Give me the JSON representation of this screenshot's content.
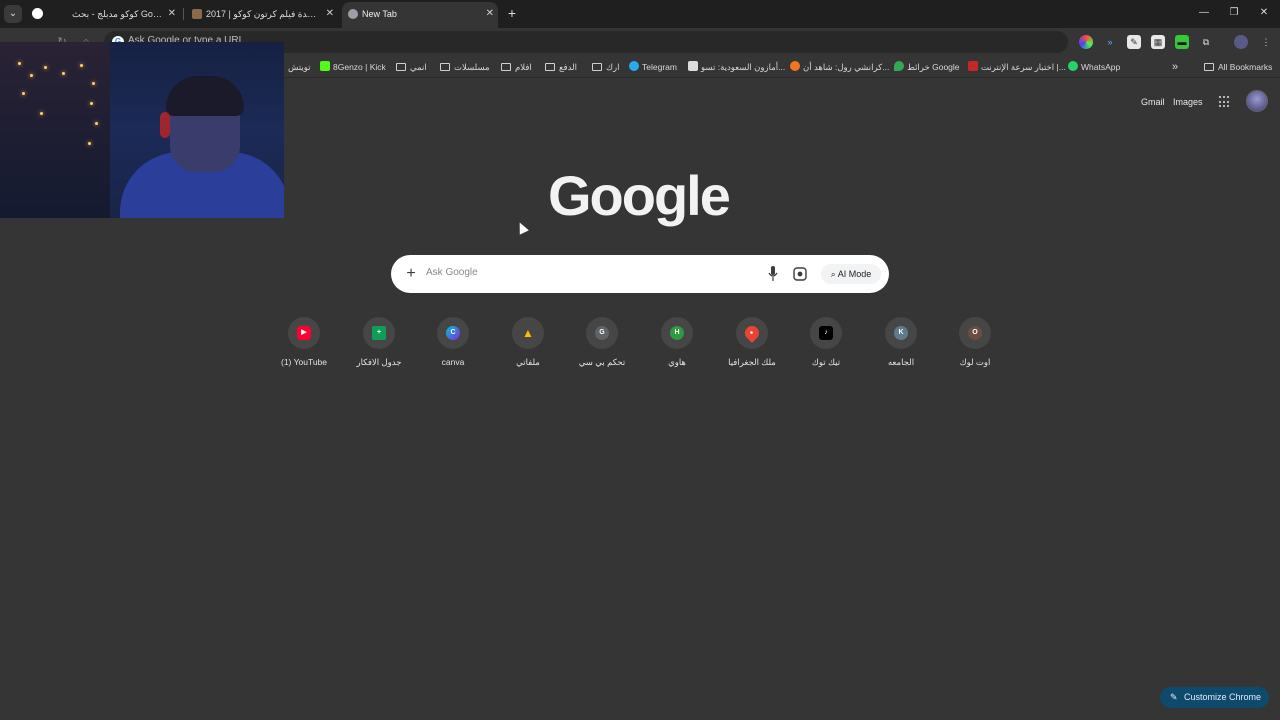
{
  "tabs": [
    {
      "title": "كوكو مدبلج - بحث Google",
      "favicon_color": "#ffffff",
      "active": false
    },
    {
      "title": "مشاهدة فيلم كرتون كوكو | 2017 -",
      "favicon_color": "#8a6a4a",
      "active": false
    },
    {
      "title": "New Tab",
      "favicon_color": "#9aa0a6",
      "active": true
    }
  ],
  "tab_close_glyph": "✕",
  "newtab_glyph": "+",
  "window_controls": {
    "minimize": "—",
    "restore": "❐",
    "close": "✕"
  },
  "omnibox": {
    "placeholder": "Ask Google or type a URL",
    "icon_letter": "G"
  },
  "bookmarks": {
    "items": [
      {
        "label": "WhatsApp",
        "type": "site",
        "color": "#25d366"
      },
      {
        "label": "اختبار سرعة الإنترنت |...",
        "type": "site",
        "color": "#c62828"
      },
      {
        "label": "خرائط Google",
        "type": "site",
        "color": "#34a853"
      },
      {
        "label": "كرانشي رول: شاهد أن...",
        "type": "site",
        "color": "#f47521"
      },
      {
        "label": "أمازون السعودية: تسو...",
        "type": "site",
        "color": "#dddddd"
      },
      {
        "label": "Telegram",
        "type": "site",
        "color": "#2aabee"
      },
      {
        "label": "ارك",
        "type": "folder"
      },
      {
        "label": "الدفع",
        "type": "folder"
      },
      {
        "label": "افلام",
        "type": "folder"
      },
      {
        "label": "مسلسلات",
        "type": "folder"
      },
      {
        "label": "انمي",
        "type": "folder"
      },
      {
        "label": "8Genzo | Kick",
        "type": "site",
        "color": "#53fc18"
      },
      {
        "label": "تويتش",
        "type": "site",
        "color": "#9146ff"
      }
    ],
    "overflow": "»",
    "all_bookmarks": "All Bookmarks"
  },
  "top_links": {
    "gmail": "Gmail",
    "images": "Images"
  },
  "logo": "Google",
  "search": {
    "placeholder": "Ask Google",
    "plus": "+",
    "ai_mode": "AI Mode"
  },
  "shortcuts": [
    {
      "label": "(1) YouTube",
      "icon": "youtube-icon",
      "letter": "▶",
      "color": "#ff0033"
    },
    {
      "label": "جدول الافكار",
      "icon": "sheets-icon",
      "letter": "+",
      "color": "#0f9d58"
    },
    {
      "label": "canva",
      "icon": "canva-icon",
      "letter": "C",
      "color": "#00c4cc"
    },
    {
      "label": "ملفاتي",
      "icon": "drive-icon",
      "letter": "▲",
      "color": "#fbbc04"
    },
    {
      "label": "تحكم بي سي",
      "icon": "letter-g-icon",
      "letter": "G",
      "color": "#5f6368"
    },
    {
      "label": "هاوي",
      "icon": "letter-h-icon",
      "letter": "H",
      "color": "#2e9b3f"
    },
    {
      "label": "ملك الجغرافيا",
      "icon": "map-pin-icon",
      "letter": "●",
      "color": "#ea4335"
    },
    {
      "label": "تيك توك",
      "icon": "tiktok-icon",
      "letter": "♪",
      "color": "#000000"
    },
    {
      "label": "الجامعه",
      "icon": "letter-k-icon",
      "letter": "K",
      "color": "#5f7a8a"
    },
    {
      "label": "اوت لوك",
      "icon": "letter-o-icon",
      "letter": "O",
      "color": "#6d4c41"
    }
  ],
  "customize": {
    "label": "Customize Chrome",
    "icon": "✎"
  },
  "colors": {
    "page_bg": "#353535",
    "tabstrip_bg": "#1f1f1f",
    "accent": "#0e4a6b"
  }
}
